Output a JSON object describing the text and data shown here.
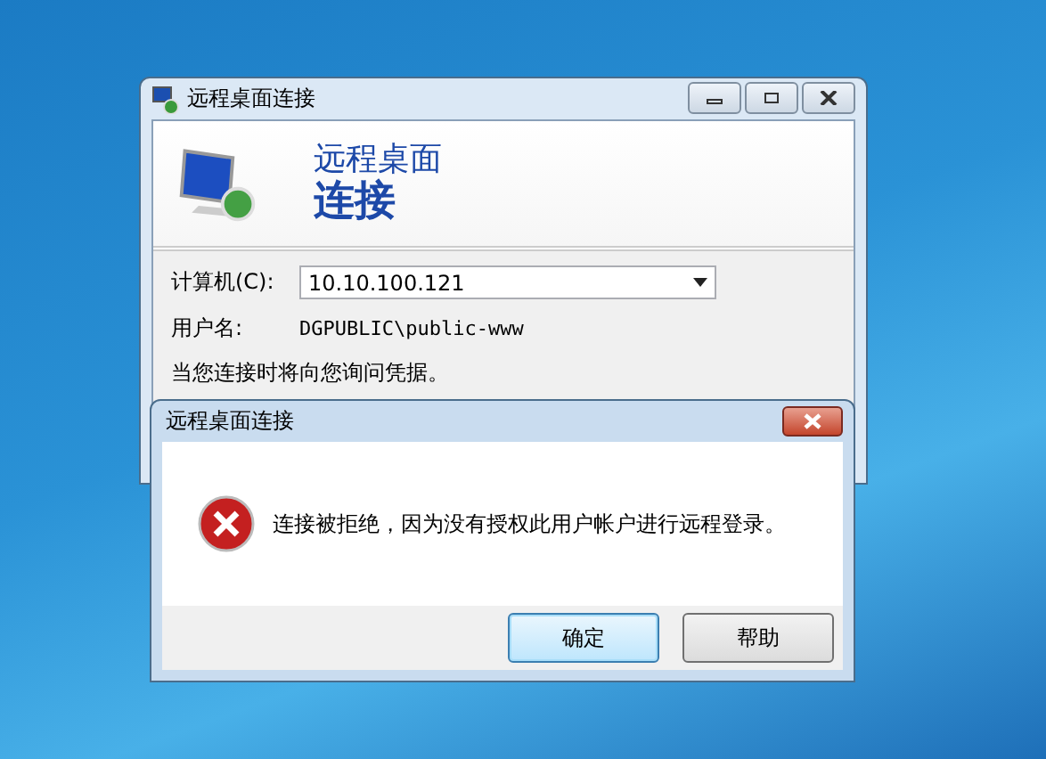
{
  "main_window": {
    "title": "远程桌面连接",
    "header": {
      "line_1": "远程桌面",
      "line_2": "连接"
    },
    "computer": {
      "label": "计算机(C):",
      "value": "10.10.100.121"
    },
    "username": {
      "label": "用户名:",
      "value": "DGPUBLIC\\public-www"
    },
    "note": "当您连接时将向您询问凭据。"
  },
  "dialog": {
    "title": "远程桌面连接",
    "message": "连接被拒绝，因为没有授权此用户帐户进行远程登录。",
    "buttons": [
      {
        "label": "确定",
        "selected": true
      },
      {
        "label": "帮助",
        "selected": false
      }
    ]
  }
}
